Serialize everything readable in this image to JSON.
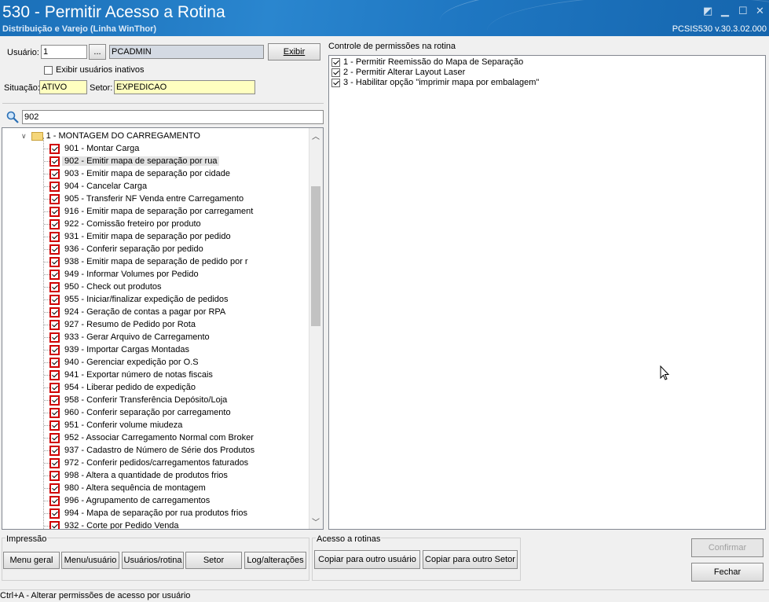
{
  "window": {
    "title": "530 - Permitir Acesso a Rotina",
    "subtitle": "Distribuição e Varejo (Linha WinThor)",
    "version": "PCSIS530  v.30.3.02.000"
  },
  "user_filter": {
    "usuario_label": "Usuário:",
    "usuario_value": "1",
    "lookup_label": "...",
    "user_name": "PCADMIN",
    "exibir_label": "Exibir",
    "inativos_label": "Exibir usuários inativos",
    "situacao_label": "Situação:",
    "situacao_value": "ATIVO",
    "setor_label": "Setor:",
    "setor_value": "EXPEDICAO"
  },
  "search": {
    "value": "902"
  },
  "tree": {
    "root_label": "1 - MONTAGEM DO CARREGAMENTO",
    "items": [
      "901 - Montar Carga",
      "902 - Emitir mapa de separação por rua",
      "903 - Emitir mapa de separação por cidade",
      "904 - Cancelar Carga",
      "905 - Transferir NF Venda entre Carregamento",
      "916 - Emitir mapa de separação por carregament",
      "922 - Comissão freteiro por produto",
      "931 - Emitir mapa de separação por pedido",
      "936 - Conferir separação por pedido",
      "938 - Emitir mapa de separação de pedido por r",
      "949 - Informar Volumes por Pedido",
      "950 - Check out produtos",
      "955 - Iniciar/finalizar expedição de pedidos",
      "924 - Geração de contas a pagar por RPA",
      "927 - Resumo de Pedido por Rota",
      "933 - Gerar Arquivo de Carregamento",
      "939 - Importar Cargas Montadas",
      "940 - Gerenciar expedição por O.S",
      "941 - Exportar número de notas fiscais",
      "954 - Liberar pedido de expedição",
      "958 - Conferir Transferência Depósito/Loja",
      "960 - Conferir separação por carregamento",
      "951 - Conferir volume miudeza",
      "952 - Associar Carregamento Normal com Broker",
      "937 - Cadastro de Número de Série dos Produtos",
      "972 - Conferir pedidos/carregamentos faturados",
      "998 - Altera a quantidade de produtos frios",
      "980 - Altera sequência de montagem",
      "996 - Agrupamento de carregamentos",
      "994 - Mapa de separação por rua produtos frios",
      "932 - Corte por Pedido Venda"
    ]
  },
  "permissions": {
    "title": "Controle de permissões na rotina",
    "items": [
      "1 - Permitir Reemissão do Mapa de Separação",
      "2 - Permitir Alterar Layout Laser",
      "3 - Habilitar opção \"imprimir mapa por embalagem\""
    ]
  },
  "impressao": {
    "title": "Impressão",
    "buttons": [
      "Menu geral",
      "Menu/usuário",
      "Usuários/rotina",
      "Setor",
      "Log/alterações"
    ]
  },
  "acesso": {
    "title": "Acesso a rotinas",
    "buttons": [
      "Copiar para outro usuário",
      "Copiar para outro Setor"
    ]
  },
  "actions": {
    "confirmar": "Confirmar",
    "fechar": "Fechar"
  },
  "status": "Ctrl+A - Alterar permissões de acesso por usuário"
}
